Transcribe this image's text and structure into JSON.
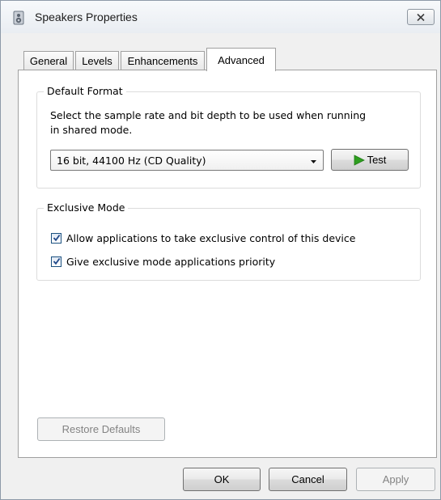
{
  "window": {
    "title": "Speakers Properties",
    "icon": "speaker-icon",
    "close_icon": "close-icon"
  },
  "tabs": [
    {
      "label": "General"
    },
    {
      "label": "Levels"
    },
    {
      "label": "Enhancements"
    },
    {
      "label": "Advanced",
      "active": true
    }
  ],
  "default_format": {
    "title": "Default Format",
    "description_line1": "Select the sample rate and bit depth to be used when running",
    "description_line2": "in shared mode.",
    "selected_format": "16 bit, 44100 Hz (CD Quality)",
    "test_label": "Test",
    "test_icon": "play-icon",
    "test_icon_color": "#2e9e1f"
  },
  "exclusive_mode": {
    "title": "Exclusive Mode",
    "options": [
      {
        "label": "Allow applications to take exclusive control of this device",
        "checked": true
      },
      {
        "label": "Give exclusive mode applications priority",
        "checked": true
      }
    ]
  },
  "restore_defaults_label": "Restore Defaults",
  "footer": {
    "ok_label": "OK",
    "cancel_label": "Cancel",
    "apply_label": "Apply"
  }
}
